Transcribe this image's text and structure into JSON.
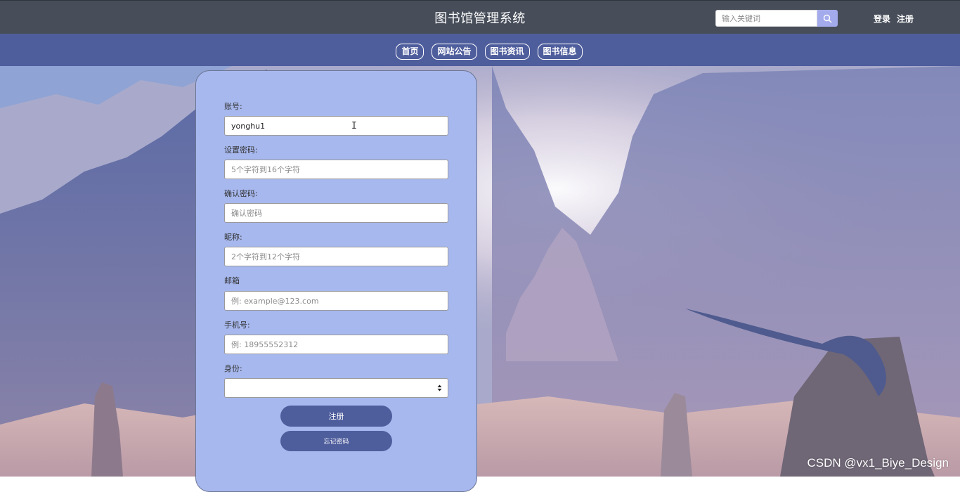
{
  "header": {
    "site_title": "图书馆管理系统",
    "search_placeholder": "输入关键词",
    "search_icon": "search-icon",
    "login_label": "登录",
    "register_label": "注册"
  },
  "nav": {
    "items": [
      {
        "label": "首页"
      },
      {
        "label": "网站公告"
      },
      {
        "label": "图书资讯"
      },
      {
        "label": "图书信息"
      }
    ]
  },
  "form": {
    "account_label": "账号:",
    "account_value": "yonghu1",
    "password_label": "设置密码:",
    "password_placeholder": "5个字符到16个字符",
    "confirm_label": "确认密码:",
    "confirm_placeholder": "确认密码",
    "nickname_label": "昵称:",
    "nickname_placeholder": "2个字符到12个字符",
    "email_label": "邮箱",
    "email_placeholder": "例: example@123.com",
    "phone_label": "手机号:",
    "phone_placeholder": "例: 18955552312",
    "identity_label": "身份:",
    "identity_value": "",
    "register_button": "注册",
    "forgot_button": "忘记密码"
  },
  "watermark": "CSDN @vx1_Biye_Design",
  "colors": {
    "topbar": "#474e5a",
    "navbar": "#4e5d9c",
    "panel": "#a7b8ee",
    "accent_button": "#4e5d9c",
    "search_button": "#a4abec"
  }
}
